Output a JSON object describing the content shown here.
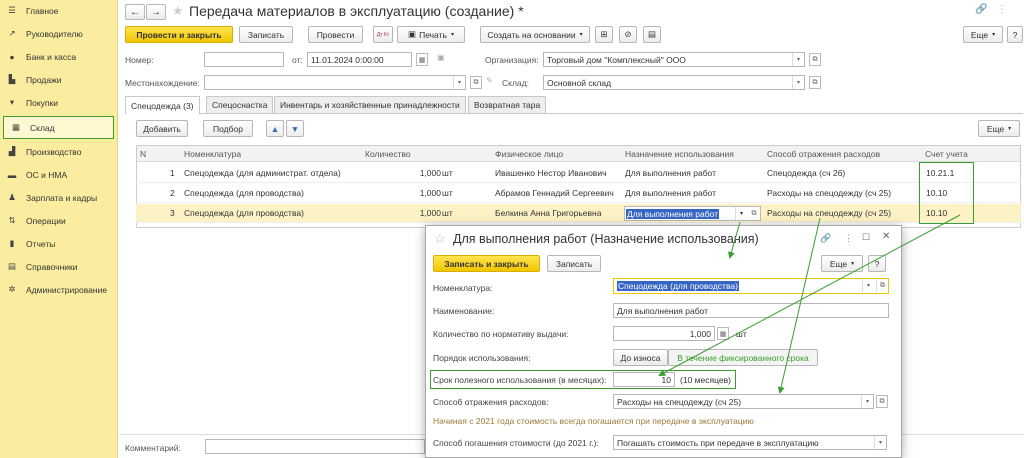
{
  "sidebar": {
    "items": [
      {
        "label": "Главное",
        "icon": "menu-icon"
      },
      {
        "label": "Руководителю",
        "icon": "chart-line-icon"
      },
      {
        "label": "Банк и касса",
        "icon": "coins-icon"
      },
      {
        "label": "Продажи",
        "icon": "shop-icon"
      },
      {
        "label": "Покупки",
        "icon": "cart-icon"
      },
      {
        "label": "Склад",
        "icon": "warehouse-icon",
        "active": true
      },
      {
        "label": "Производство",
        "icon": "factory-icon"
      },
      {
        "label": "ОС и НМА",
        "icon": "truck-icon"
      },
      {
        "label": "Зарплата и кадры",
        "icon": "person-icon"
      },
      {
        "label": "Операции",
        "icon": "operations-icon"
      },
      {
        "label": "Отчеты",
        "icon": "bar-chart-icon"
      },
      {
        "label": "Справочники",
        "icon": "book-icon"
      },
      {
        "label": "Администрирование",
        "icon": "gear-icon"
      }
    ]
  },
  "header": {
    "title": "Передача материалов в эксплуатацию (создание) *",
    "back": "←",
    "forward": "→",
    "star": "★",
    "link": "🔗",
    "more": "⋮"
  },
  "toolbar": {
    "post_close": "Провести и закрыть",
    "save": "Записать",
    "post": "Провести",
    "print": "Печать",
    "create_based": "Создать на основании",
    "more": "Еще",
    "help": "?",
    "dt_kt": "Дт Кт"
  },
  "fields": {
    "number_label": "Номер:",
    "number_value": "",
    "date_label": "от:",
    "date_value": "11.01.2024  0:00:00",
    "org_label": "Организация:",
    "org_value": "Торговый дом \"Комплексный\" ООО",
    "location_label": "Местонахождение:",
    "location_value": "",
    "warehouse_label": "Склад:",
    "warehouse_value": "Основной склад"
  },
  "tabs": [
    "Спецодежда (3)",
    "Спецоснастка",
    "Инвентарь и хозяйственные принадлежности",
    "Возвратная тара"
  ],
  "table_toolbar": {
    "add": "Добавить",
    "pick": "Подбор",
    "more": "Еще"
  },
  "table": {
    "columns": [
      "N",
      "Номенклатура",
      "Количество",
      "Физическое лицо",
      "Назначение использования",
      "Способ отражения расходов",
      "Счет учета"
    ],
    "rows": [
      {
        "n": "1",
        "item": "Спецодежда (для администрат. отдела)",
        "qty": "1,000",
        "unit": "шт",
        "person": "Ивашенко Нестор Иванович",
        "purpose": "Для выполнения работ",
        "method": "Спецодежда (сч 26)",
        "account": "10.21.1"
      },
      {
        "n": "2",
        "item": "Спецодежда (для проводства)",
        "qty": "1,000",
        "unit": "шт",
        "person": "Абрамов Геннадий Сергеевич",
        "purpose": "Для выполнения работ",
        "method": "Расходы на спецодежду (сч 25)",
        "account": "10.10"
      },
      {
        "n": "3",
        "item": "Спецодежда (для проводства)",
        "qty": "1,000",
        "unit": "шт",
        "person": "Белкина Анна Григорьевна",
        "purpose": "Для выполнения работ",
        "method": "Расходы на спецодежду (сч 25)",
        "account": "10.10"
      }
    ]
  },
  "footer": {
    "comment_label": "Комментарий:",
    "comment_value": ""
  },
  "dialog": {
    "title": "Для выполнения работ (Назначение использования)",
    "save_close": "Записать и закрыть",
    "save": "Записать",
    "more": "Еще",
    "help": "?",
    "nomenclature_label": "Номенклатура:",
    "nomenclature_value": "Спецодежда (для проводства)",
    "name_label": "Наименование:",
    "name_value": "Для выполнения работ",
    "norm_label": "Количество по нормативу выдачи:",
    "norm_value": "1,000",
    "norm_unit": "шт",
    "order_label": "Порядок использования:",
    "order_opt1": "До износа",
    "order_opt2": "В течение фиксированного срока",
    "life_label": "Срок полезного использования (в месяцах):",
    "life_value": "10",
    "life_hint": "(10 месяцев)",
    "method_label": "Способ отражения расходов:",
    "method_value": "Расходы на спецодежду (сч 25)",
    "note": "Начиная с 2021 года стоимость всегда погашается при передаче в эксплуатацию",
    "repay_label": "Способ погашения стоимости (до 2021 г.):",
    "repay_value": "Погашать стоимость при передаче в эксплуатацию"
  },
  "colors": {
    "accent_yellow": "#f5cf00",
    "sidebar_bg": "#fbeda0",
    "highlight_green": "#3a9d2e",
    "selected_row": "#fdf2c6",
    "note_text": "#9a7b3a"
  }
}
